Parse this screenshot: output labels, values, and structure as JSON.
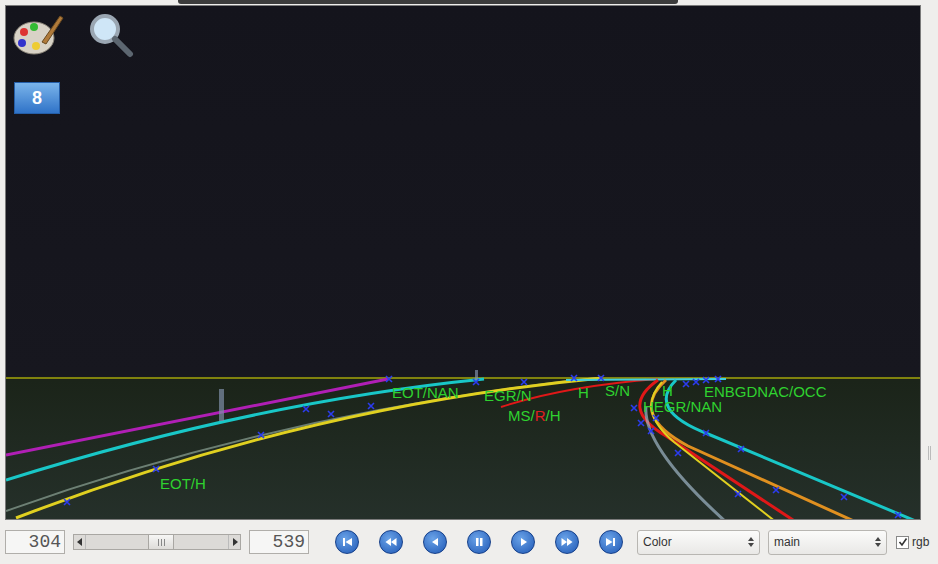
{
  "video": {
    "frame_badge": "8",
    "labels": [
      {
        "parts": [
          {
            "text": "EOT/NAN",
            "color": "#2fd22f"
          }
        ]
      },
      {
        "parts": [
          {
            "text": "EGR/N",
            "color": "#2fd22f"
          }
        ]
      },
      {
        "parts": [
          {
            "text": "H",
            "color": "#2fd22f"
          }
        ]
      },
      {
        "parts": [
          {
            "text": "S/N",
            "color": "#2fd22f"
          }
        ]
      },
      {
        "parts": [
          {
            "text": "H",
            "color": "#2fd22f"
          }
        ]
      },
      {
        "parts": [
          {
            "text": "ENBGDNAC/OCC",
            "color": "#2fd22f"
          }
        ]
      },
      {
        "parts": [
          {
            "text": "HEGR/NAN",
            "color": "#2fd22f"
          }
        ]
      },
      {
        "parts": [
          {
            "text": "MS/",
            "color": "#2fd22f"
          },
          {
            "text": "R",
            "color": "#e02020"
          },
          {
            "text": "/H",
            "color": "#2fd22f"
          }
        ]
      },
      {
        "parts": [
          {
            "text": "EOT/H",
            "color": "#2fd22f"
          }
        ]
      }
    ]
  },
  "player": {
    "current_frame": "304",
    "total_frames": "539",
    "position": {
      "level": 0.53
    },
    "view_mode": "Color",
    "channel": "main",
    "rgb": {
      "label": "rgb",
      "checked": true
    }
  }
}
